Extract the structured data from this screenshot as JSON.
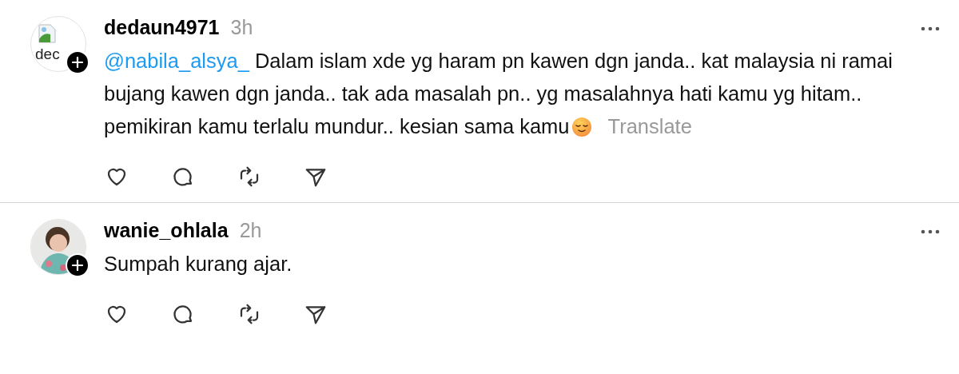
{
  "posts": [
    {
      "username": "dedaun4971",
      "time": "3h",
      "avatar": {
        "kind": "broken",
        "alt_text": "dec"
      },
      "mention": "@nabila_alsya_",
      "text": "Dalam islam xde yg haram pn kawen dgn janda.. kat malaysia ni ramai bujang kawen dgn janda.. tak ada masalah pn.. yg masalahnya hati kamu yg hitam.. pemikiran kamu terlalu mundur.. kesian sama kamu",
      "emoji": true,
      "translate": "Translate"
    },
    {
      "username": "wanie_ohlala",
      "time": "2h",
      "text": "Sumpah kurang ajar."
    }
  ]
}
